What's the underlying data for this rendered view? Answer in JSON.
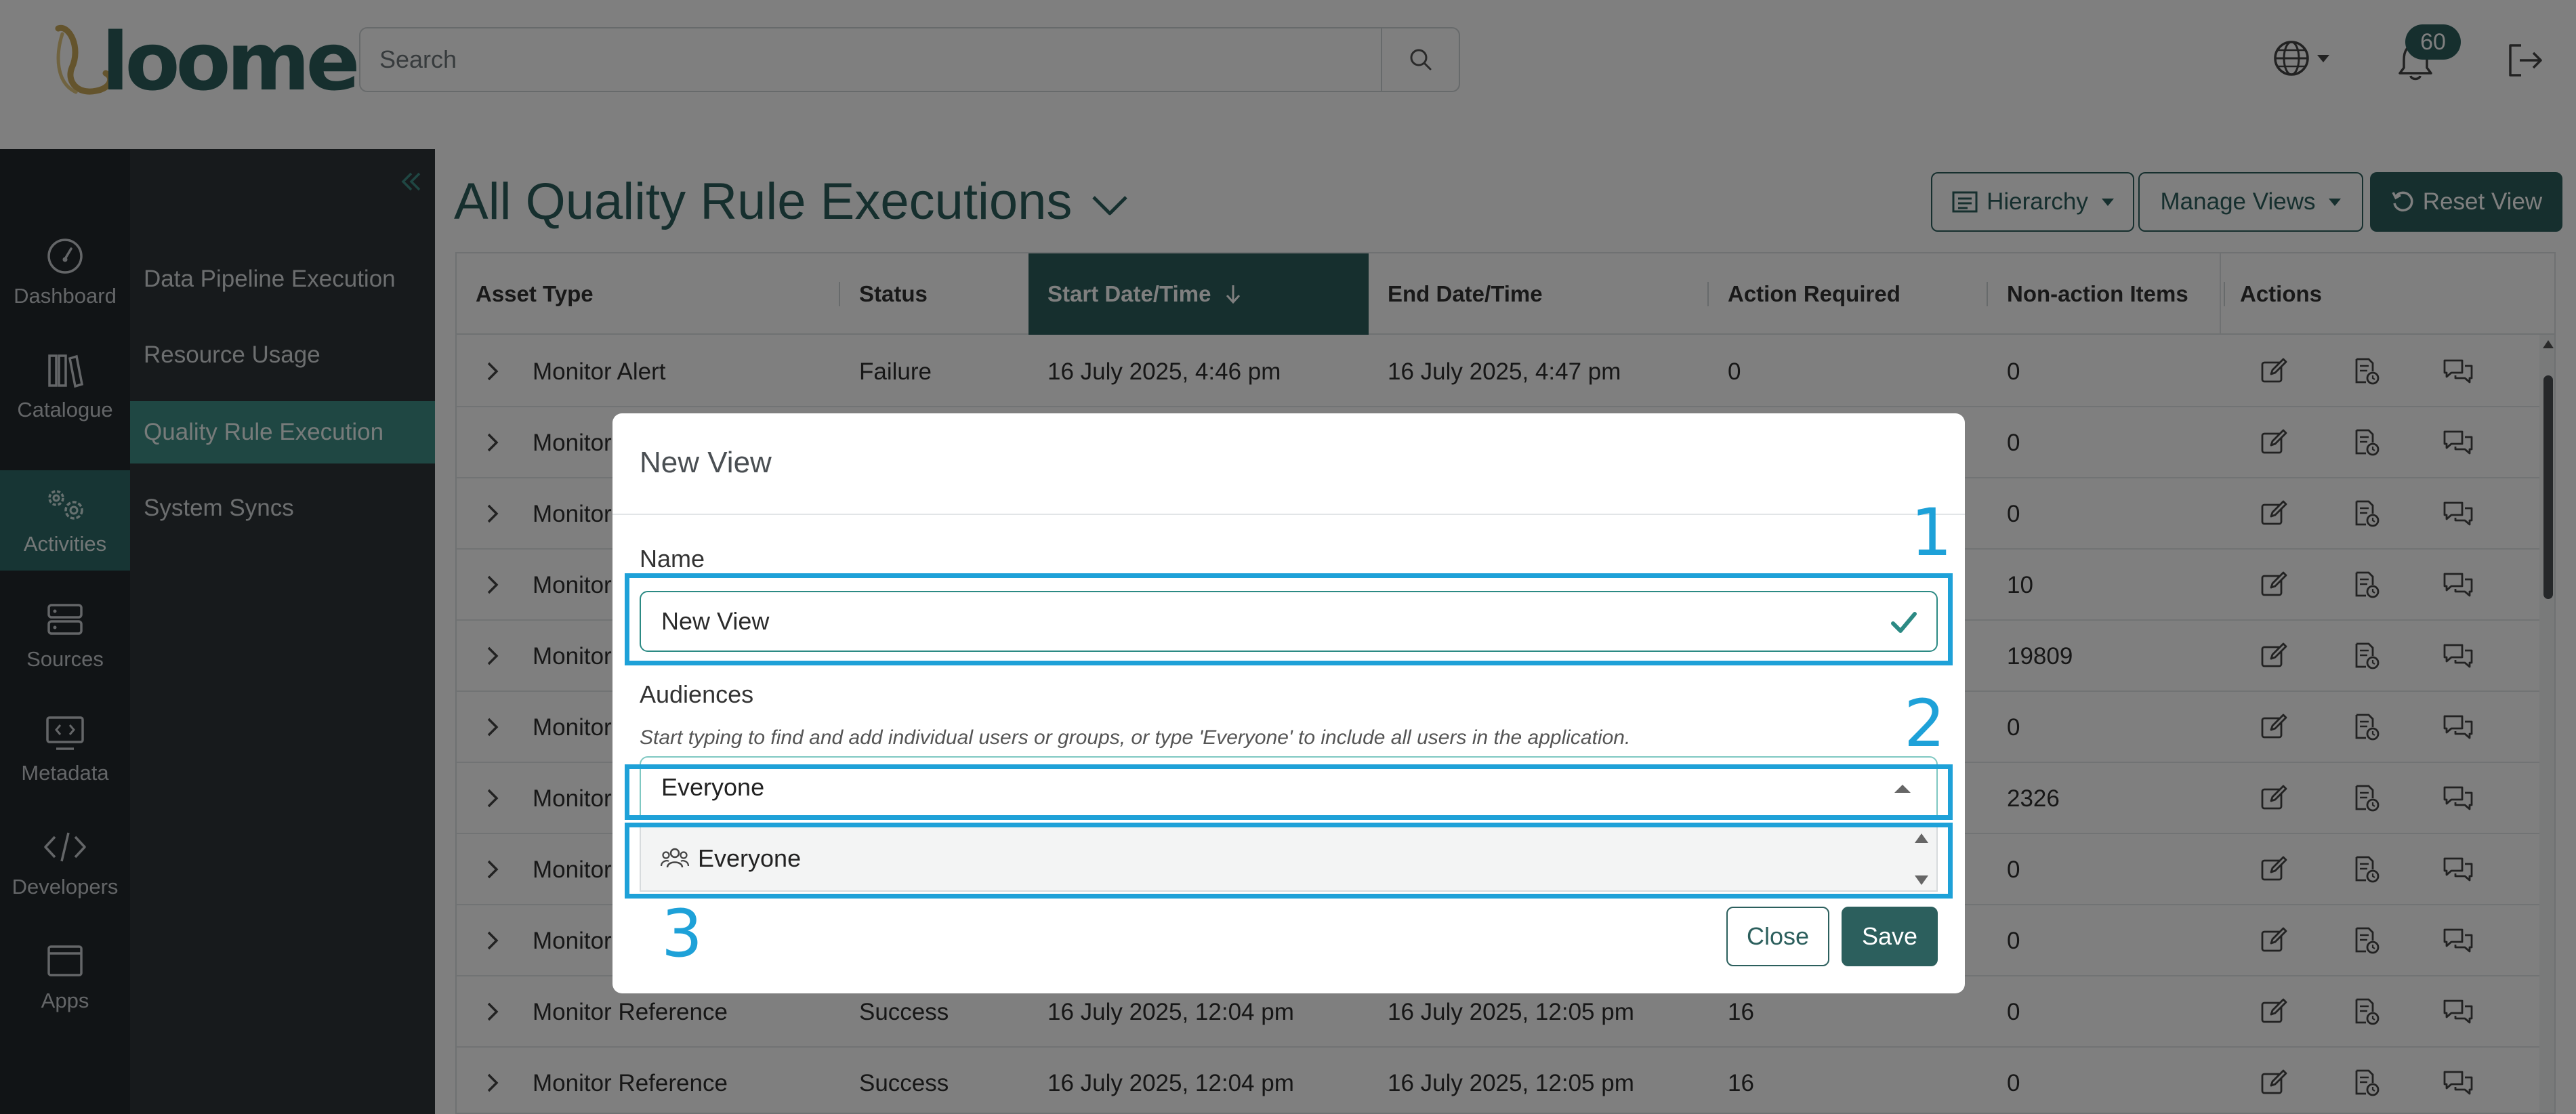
{
  "header": {
    "logo_text": "loome",
    "search_placeholder": "Search",
    "notification_count": "60"
  },
  "rail": {
    "items": [
      {
        "label": "Dashboard",
        "icon": "gauge-icon"
      },
      {
        "label": "Catalogue",
        "icon": "books-icon"
      },
      {
        "label": "Activities",
        "icon": "gears-icon",
        "active": true
      },
      {
        "label": "Sources",
        "icon": "database-icon"
      },
      {
        "label": "Metadata",
        "icon": "code-monitor-icon"
      },
      {
        "label": "Developers",
        "icon": "code-icon"
      },
      {
        "label": "Apps",
        "icon": "window-icon"
      }
    ]
  },
  "subnav": {
    "items": [
      {
        "label": "Data Pipeline Execution"
      },
      {
        "label": "Resource Usage"
      },
      {
        "label": "Quality Rule Execution",
        "active": true
      },
      {
        "label": "System Syncs"
      }
    ]
  },
  "main": {
    "title": "All Quality Rule Executions",
    "buttons": {
      "hierarchy": "Hierarchy",
      "manage_views": "Manage Views",
      "reset_view": "Reset View"
    },
    "columns": [
      "Asset Type",
      "Status",
      "Start Date/Time",
      "End Date/Time",
      "Action Required",
      "Non-action Items",
      "Actions"
    ],
    "sorted_column": "Start Date/Time",
    "rows": [
      {
        "asset": "Monitor Alert",
        "status": "Failure",
        "start": "16 July 2025, 4:46 pm",
        "end": "16 July 2025, 4:47 pm",
        "action": "0",
        "nonaction": "0"
      },
      {
        "asset": "Monitor",
        "status": "",
        "start": "",
        "end": "",
        "action": "",
        "nonaction": "0"
      },
      {
        "asset": "Monitor",
        "status": "",
        "start": "",
        "end": "",
        "action": "",
        "nonaction": "0"
      },
      {
        "asset": "Monitor",
        "status": "",
        "start": "",
        "end": "",
        "action": "",
        "nonaction": "10"
      },
      {
        "asset": "Monitor",
        "status": "",
        "start": "",
        "end": "",
        "action": "",
        "nonaction": "19809"
      },
      {
        "asset": "Monitor",
        "status": "",
        "start": "",
        "end": "",
        "action": "",
        "nonaction": "0"
      },
      {
        "asset": "Monitor",
        "status": "",
        "start": "",
        "end": "",
        "action": "",
        "nonaction": "2326"
      },
      {
        "asset": "Monitor",
        "status": "",
        "start": "",
        "end": "",
        "action": "",
        "nonaction": "0"
      },
      {
        "asset": "Monitor",
        "status": "",
        "start": "",
        "end": "",
        "action": "",
        "nonaction": "0"
      },
      {
        "asset": "Monitor Reference",
        "status": "Success",
        "start": "16 July 2025, 12:04 pm",
        "end": "16 July 2025, 12:05 pm",
        "action": "16",
        "nonaction": "0"
      },
      {
        "asset": "Monitor Reference",
        "status": "Success",
        "start": "16 July 2025, 12:04 pm",
        "end": "16 July 2025, 12:05 pm",
        "action": "16",
        "nonaction": "0"
      }
    ]
  },
  "modal": {
    "title": "New View",
    "name_label": "Name",
    "name_value": "New View",
    "audiences_label": "Audiences",
    "audiences_hint": "Start typing to find and add individual users or groups, or type 'Everyone' to include all users in the application.",
    "audiences_value": "Everyone",
    "dropdown_option": "Everyone",
    "close_label": "Close",
    "save_label": "Save"
  },
  "callouts": [
    "1",
    "2",
    "3"
  ],
  "colors": {
    "brand": "#2c5f5d",
    "active_nav": "#3f8e86",
    "callout": "#1ea1d8",
    "sidebar": "#23282d"
  }
}
